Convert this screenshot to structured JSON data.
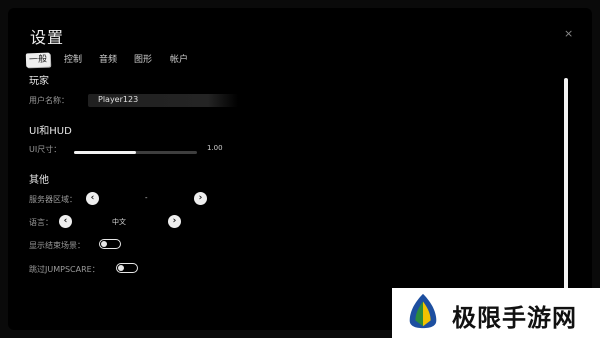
{
  "window": {
    "title": "设置",
    "close_glyph": "×"
  },
  "tabs": [
    {
      "label": "一般",
      "active": true
    },
    {
      "label": "控制",
      "active": false
    },
    {
      "label": "音频",
      "active": false
    },
    {
      "label": "图形",
      "active": false
    },
    {
      "label": "帐户",
      "active": false
    }
  ],
  "player": {
    "heading": "玩家",
    "username_label": "用户名称：",
    "username_value": "Player123"
  },
  "ui_hud": {
    "heading": "UI和HUD",
    "ui_size_label": "UI尺寸：",
    "ui_size_value": "1.00",
    "ui_size_fraction": 0.5
  },
  "other": {
    "heading": "其他",
    "server_region_label": "服务器区域：",
    "server_region_value": "-",
    "language_label": "语言：",
    "language_value": "中文",
    "show_end_scene_label": "显示结束场景：",
    "show_end_scene_on": false,
    "skip_jumpscare_label": "跳过JUMPSCARE：",
    "skip_jumpscare_on": false
  },
  "icons": {
    "prev": "‹",
    "next": "›"
  },
  "colors": {
    "background": "#000000",
    "accent": "#eeeeee",
    "label": "#9a9a9a"
  },
  "watermark": {
    "text": "极限手游网"
  }
}
